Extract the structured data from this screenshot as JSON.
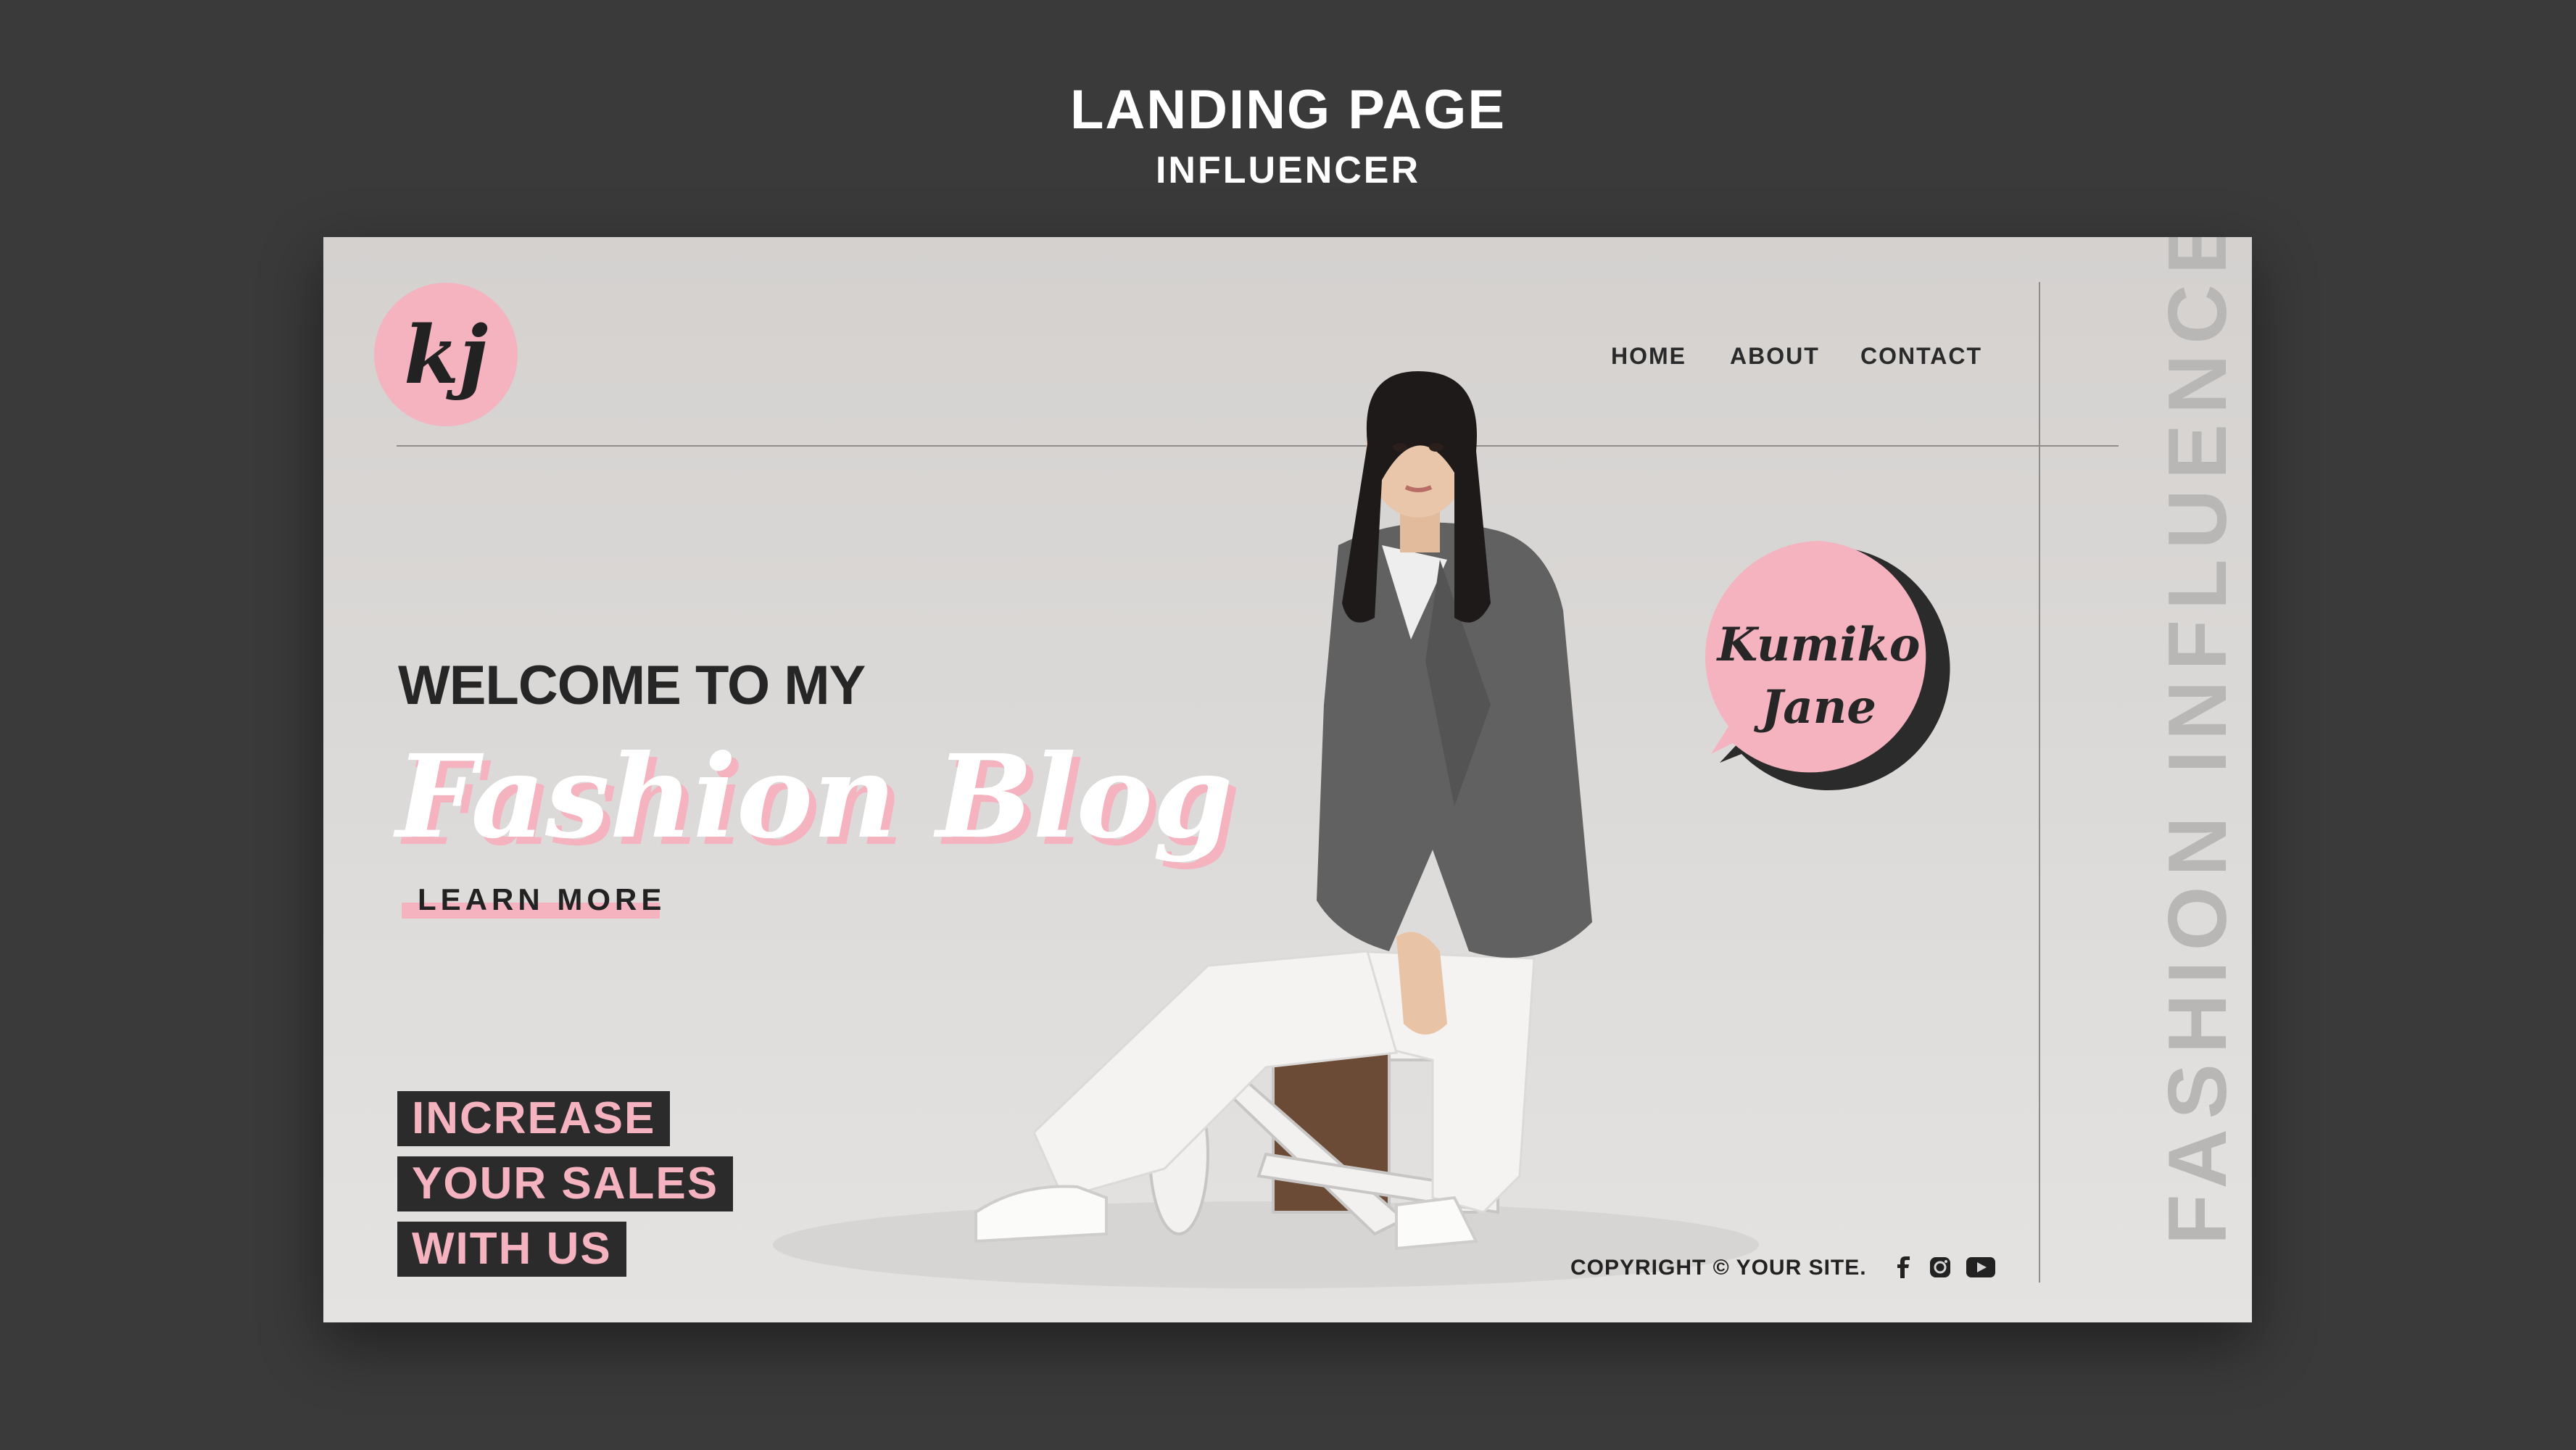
{
  "header": {
    "title": "LANDING PAGE",
    "subtitle": "INFLUENCER"
  },
  "site": {
    "logo": "kj",
    "nav": [
      "HOME",
      "ABOUT",
      "CONTACT"
    ],
    "active_nav": "HOME",
    "side_text": "FASHION INFLUENCER",
    "welcome": "WELCOME TO MY",
    "headline": "Fashion Blog",
    "cta": "LEARN MORE",
    "promo": [
      "INCREASE",
      "YOUR SALES",
      "WITH US"
    ],
    "bubble_name": [
      "Kumiko",
      "Jane"
    ],
    "copyright": "COPYRIGHT © YOUR SITE.",
    "social_icons": [
      "facebook-icon",
      "instagram-icon",
      "youtube-icon"
    ]
  },
  "colors": {
    "background": "#3a3a3a",
    "card": "#d8d6d4",
    "accent_pink": "#f5b3c0",
    "dark": "#2b2b2b"
  }
}
